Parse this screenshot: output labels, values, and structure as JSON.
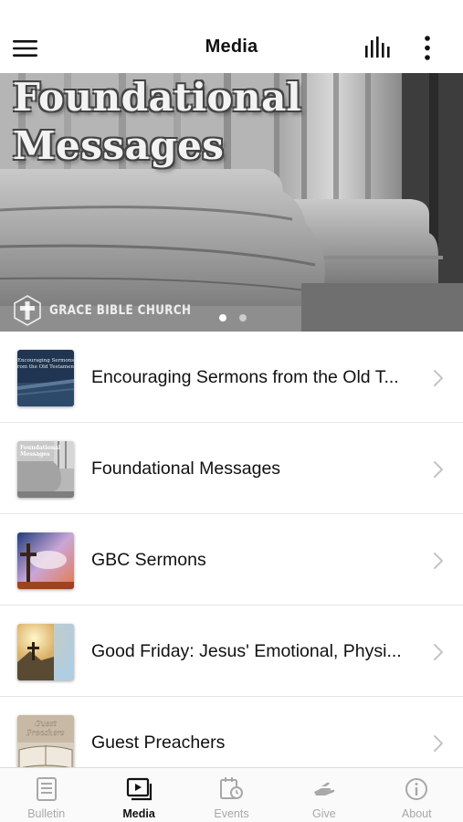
{
  "header": {
    "title": "Media",
    "menu_icon": "hamburger-menu-icon",
    "chart_icon": "audio-bars-icon",
    "more_icon": "vertical-ellipsis-icon"
  },
  "hero": {
    "title": "Foundational\nMessages",
    "logo_text": "GRACE BIBLE CHURCH",
    "logo_icon": "cross-shield-icon",
    "slides": 2,
    "active_slide": 0
  },
  "list": {
    "items": [
      {
        "label": "Encouraging Sermons from the Old T...",
        "thumb_text": "Encouraging Sermons from the Old Testament",
        "chevron": "chevron-right-icon"
      },
      {
        "label": "Foundational Messages",
        "thumb_text": "",
        "chevron": "chevron-right-icon"
      },
      {
        "label": "GBC Sermons",
        "thumb_text": "",
        "chevron": "chevron-right-icon"
      },
      {
        "label": "Good Friday: Jesus' Emotional, Physi...",
        "thumb_text": "",
        "chevron": "chevron-right-icon"
      },
      {
        "label": "Guest Preachers",
        "thumb_text": "Guest Preachers",
        "chevron": "chevron-right-icon"
      }
    ]
  },
  "tabbar": {
    "tabs": [
      {
        "label": "Bulletin",
        "icon": "bulletin-icon"
      },
      {
        "label": "Media",
        "icon": "media-play-icon"
      },
      {
        "label": "Events",
        "icon": "calendar-clock-icon"
      },
      {
        "label": "Give",
        "icon": "giving-hand-icon"
      },
      {
        "label": "About",
        "icon": "info-icon"
      }
    ],
    "active": "Media"
  },
  "colors": {
    "active_tab": "#111111",
    "inactive_tab": "#a8a8a8",
    "divider": "#e6e6e6"
  }
}
